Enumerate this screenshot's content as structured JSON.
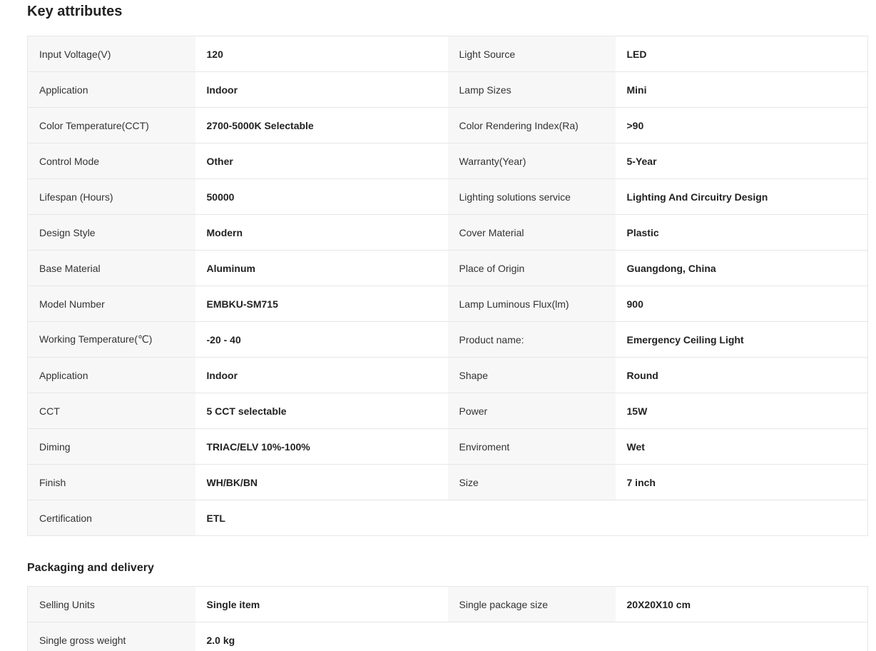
{
  "key_attributes": {
    "title": "Key attributes",
    "rows": [
      [
        {
          "label": "Input Voltage(V)",
          "value": "120"
        },
        {
          "label": "Light Source",
          "value": "LED"
        }
      ],
      [
        {
          "label": "Application",
          "value": "Indoor"
        },
        {
          "label": "Lamp Sizes",
          "value": "Mini"
        }
      ],
      [
        {
          "label": "Color Temperature(CCT)",
          "value": "2700-5000K Selectable"
        },
        {
          "label": "Color Rendering Index(Ra)",
          "value": ">90"
        }
      ],
      [
        {
          "label": "Control Mode",
          "value": "Other"
        },
        {
          "label": "Warranty(Year)",
          "value": "5-Year"
        }
      ],
      [
        {
          "label": "Lifespan (Hours)",
          "value": "50000"
        },
        {
          "label": "Lighting solutions service",
          "value": "Lighting And Circuitry Design"
        }
      ],
      [
        {
          "label": "Design Style",
          "value": "Modern"
        },
        {
          "label": "Cover Material",
          "value": "Plastic"
        }
      ],
      [
        {
          "label": "Base Material",
          "value": "Aluminum"
        },
        {
          "label": "Place of Origin",
          "value": "Guangdong, China"
        }
      ],
      [
        {
          "label": "Model Number",
          "value": "EMBKU-SM715"
        },
        {
          "label": "Lamp Luminous Flux(lm)",
          "value": "900"
        }
      ],
      [
        {
          "label": "Working Temperature(℃)",
          "value": "-20 - 40"
        },
        {
          "label": "Product name:",
          "value": "Emergency Ceiling Light"
        }
      ],
      [
        {
          "label": "Application",
          "value": "Indoor"
        },
        {
          "label": "Shape",
          "value": "Round"
        }
      ],
      [
        {
          "label": "CCT",
          "value": "5 CCT selectable"
        },
        {
          "label": "Power",
          "value": "15W"
        }
      ],
      [
        {
          "label": "Diming",
          "value": "TRIAC/ELV 10%-100%"
        },
        {
          "label": "Enviroment",
          "value": "Wet"
        }
      ],
      [
        {
          "label": "Finish",
          "value": "WH/BK/BN"
        },
        {
          "label": "Size",
          "value": "7 inch"
        }
      ],
      [
        {
          "label": "Certification",
          "value": "ETL"
        }
      ]
    ]
  },
  "packaging": {
    "title": "Packaging and delivery",
    "rows": [
      [
        {
          "label": "Selling Units",
          "value": "Single item"
        },
        {
          "label": "Single package size",
          "value": "20X20X10 cm"
        }
      ],
      [
        {
          "label": "Single gross weight",
          "value": "2.0 kg"
        }
      ]
    ]
  }
}
